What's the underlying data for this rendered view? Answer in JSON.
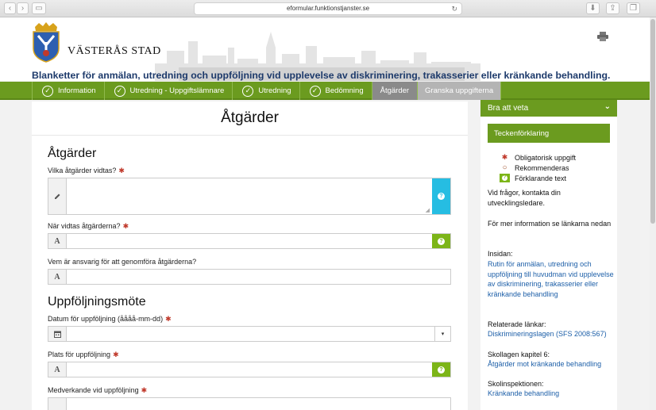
{
  "browser": {
    "url": "eformular.funktionstjanster.se"
  },
  "header": {
    "brand": "VÄSTERÅS STAD",
    "title": "Blanketter för anmälan, utredning och uppföljning vid upplevelse av diskriminering, trakasserier eller kränkande behandling."
  },
  "steps": [
    {
      "label": "Information"
    },
    {
      "label": "Utredning - Uppgiftslämnare"
    },
    {
      "label": "Utredning"
    },
    {
      "label": "Bedömning"
    },
    {
      "label": "Åtgärder"
    },
    {
      "label": "Granska uppgifterna"
    }
  ],
  "form": {
    "page_heading": "Åtgärder",
    "section1": "Åtgärder",
    "section2": "Uppföljningsmöte",
    "required_mark": "✱",
    "fields": {
      "vilka": {
        "label": "Vilka åtgärder vidtas?",
        "value": ""
      },
      "nar": {
        "label": "När vidtas åtgärderna?",
        "value": ""
      },
      "vem": {
        "label": "Vem är ansvarig för att genomföra åtgärderna?",
        "value": ""
      },
      "datum": {
        "label": "Datum för uppföljning (åååå-mm-dd)",
        "value": ""
      },
      "plats": {
        "label": "Plats för uppföljning",
        "value": ""
      },
      "medverkande": {
        "label": "Medverkande vid uppföljning",
        "value": ""
      }
    },
    "text_addon": "A",
    "help_mark": "?"
  },
  "sidebar": {
    "heading": "Bra att veta",
    "legend_title": "Teckenförklaring",
    "legend": [
      {
        "symbol": "✱",
        "text": "Obligatorisk uppgift"
      },
      {
        "symbol": "○",
        "text": "Rekommenderas"
      },
      {
        "symbol": "?",
        "text": "Förklarande text"
      }
    ],
    "contact": "Vid frågor, kontakta din utvecklingsledare.",
    "more_info": "För mer information se länkarna nedan",
    "insidan_label": "Insidan:",
    "insidan_link": "Rutin för anmälan, utredning och uppföljning till huvudman vid upplevelse av diskriminering, trakasserier eller kränkande behandling",
    "related_label": "Relaterade länkar:",
    "related_link": "Diskrimineringslagen (SFS 2008:567)",
    "skollagen_label": "Skollagen kapitel 6:",
    "skollagen_link": "Åtgärder mot kränkande behandling",
    "skolinsp_label": "Skolinspektionen:",
    "skolinsp_link": "Kränkande behandling"
  },
  "colors": {
    "green": "#6b9b1f",
    "help_green": "#7cb518",
    "help_blue": "#26bde2",
    "title_blue": "#1d3a6b",
    "link_blue": "#1d5fa8"
  }
}
